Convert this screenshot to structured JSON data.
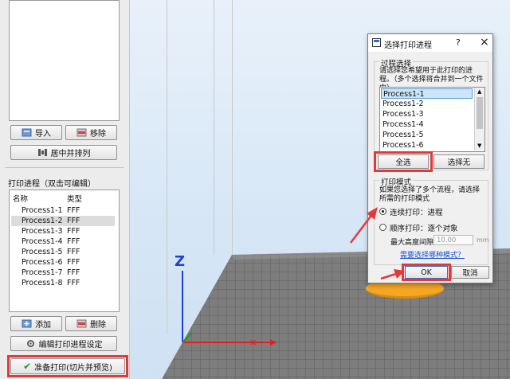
{
  "left_panel": {
    "import_label": "导入",
    "remove_label": "移除",
    "center_arrange_label": "居中并排列",
    "processes_title": "打印进程（双击可编辑）",
    "col_name": "名称",
    "col_type": "类型",
    "processes": [
      {
        "name": "Process1-1",
        "type": "FFF"
      },
      {
        "name": "Process1-2",
        "type": "FFF"
      },
      {
        "name": "Process1-3",
        "type": "FFF"
      },
      {
        "name": "Process1-4",
        "type": "FFF"
      },
      {
        "name": "Process1-5",
        "type": "FFF"
      },
      {
        "name": "Process1-6",
        "type": "FFF"
      },
      {
        "name": "Process1-7",
        "type": "FFF"
      },
      {
        "name": "Process1-8",
        "type": "FFF"
      }
    ],
    "add_label": "添加",
    "delete_label": "删除",
    "edit_settings_label": "编辑打印进程设定",
    "prepare_label": "准备打印(切片并预览)"
  },
  "viewport": {
    "axis_z_label": "Z"
  },
  "dialog": {
    "title": "选择打印进程",
    "help_label": "?",
    "close_label": "×",
    "group_process_title": "过程选择",
    "instruction": "请选择您希望用于此打印的进程。（多个选择将合并到一个文件中）",
    "processes": [
      "Process1-1",
      "Process1-2",
      "Process1-3",
      "Process1-4",
      "Process1-5",
      "Process1-6"
    ],
    "select_all_label": "全选",
    "select_none_label": "选择无",
    "group_mode_title": "打印模式",
    "mode_hint": "如果您选择了多个流程，请选择所需的打印模式",
    "mode_continuous": "连续打印：进程",
    "mode_sequential": "顺序打印：逐个对象",
    "max_height_label": "最大高度间隙",
    "max_height_value": "10.00",
    "height_unit": "mm",
    "help_link": "需要选择哪种模式？",
    "ok_label": "OK",
    "cancel_label": "取消"
  },
  "colors": {
    "highlight_red": "#e23a3a",
    "axis_z": "#1f3fd6",
    "axis_x": "#e02020",
    "axis_y": "#18a018",
    "floor": "#7a7a7a",
    "model_orange": "#f5a623",
    "selection_blue": "#cce4f7"
  }
}
